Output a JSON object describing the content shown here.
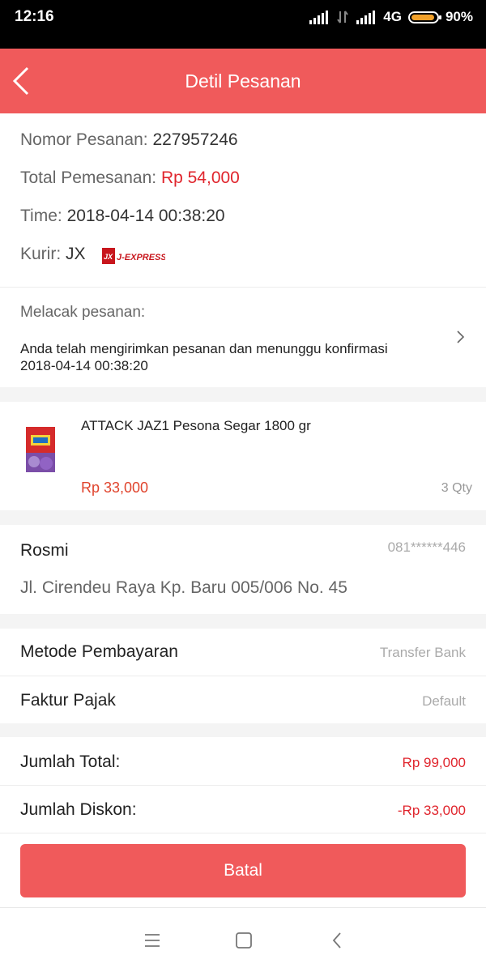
{
  "status_bar": {
    "time": "12:16",
    "network": "4G",
    "battery": "90%",
    "battery_level": 0.9
  },
  "header": {
    "title": "Detil Pesanan"
  },
  "order": {
    "number_label": "Nomor Pesanan:",
    "number_value": "227957246",
    "total_label": "Total Pemesanan:",
    "total_value": "Rp 54,000",
    "time_label": "Time:",
    "time_value": "2018-04-14 00:38:20",
    "courier_label": "Kurir:",
    "courier_value": "JX",
    "courier_logo_text": "J-EXPRESS",
    "courier_logo_mark": "JX"
  },
  "tracking": {
    "label": "Melacak pesanan:",
    "message": "Anda telah mengirimkan pesanan dan menunggu konfirmasi",
    "timestamp": "2018-04-14 00:38:20"
  },
  "product": {
    "name": "ATTACK JAZ1 Pesona Segar 1800 gr",
    "price": "Rp 33,000",
    "qty": "3 Qty"
  },
  "recipient": {
    "name": "Rosmi",
    "phone": "081******446",
    "address": "Jl. Cirendeu Raya Kp. Baru 005/006 No. 45"
  },
  "payment": {
    "method_label": "Metode Pembayaran",
    "method_value": "Transfer Bank",
    "tax_label": "Faktur Pajak",
    "tax_value": "Default"
  },
  "summary": {
    "total_label": "Jumlah Total:",
    "total_value": "Rp 99,000",
    "discount_label": "Jumlah Diskon:",
    "discount_value": "-Rp 33,000"
  },
  "actions": {
    "cancel_label": "Batal"
  },
  "colors": {
    "accent": "#f05a5b",
    "price_red": "#e0252d"
  }
}
